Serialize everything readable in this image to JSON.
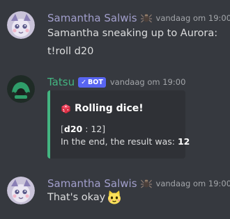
{
  "messages": [
    {
      "author": "Samantha Salwis",
      "author_color": "#a29fcc",
      "timestamp": "vandaag om 19:00",
      "lines": [
        "Samantha sneaking up to Aurora:",
        "t!roll d20"
      ]
    },
    {
      "author": "Tatsu",
      "author_color": "#43b581",
      "bot_tag": "BOT",
      "timestamp": "vandaag om 19:00",
      "embed": {
        "title": "Rolling dice!",
        "roll_open": "[",
        "roll_die": "d20",
        "roll_sep": " : 12]",
        "result_prefix": "In the end, the result was: ",
        "result_value": "12",
        "accent": "#43b581"
      }
    },
    {
      "author": "Samantha Salwis",
      "author_color": "#a29fcc",
      "timestamp": "vandaag om 19:00",
      "lines": [
        "That's okay"
      ]
    }
  ],
  "icons": {
    "author_badge": "spider-badge-icon",
    "dice": "dice-icon",
    "emoji": "cat-face-emoji-icon",
    "bot_verified": "check-icon"
  }
}
